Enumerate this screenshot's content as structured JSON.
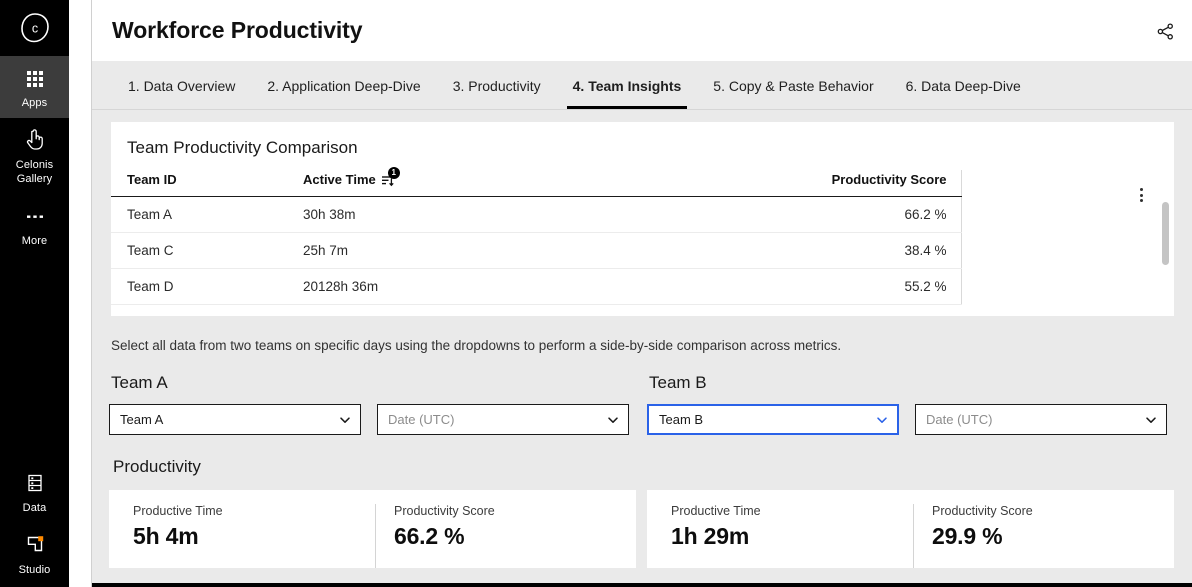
{
  "sidebar": {
    "logo": "celonis-logo",
    "items": [
      {
        "label": "Apps",
        "icon": "apps-grid-icon",
        "active": true
      },
      {
        "label": "Celonis\nGallery",
        "icon": "hand-pointer-icon",
        "active": false
      },
      {
        "label": "More",
        "icon": "ellipsis-icon",
        "active": false
      }
    ],
    "bottom_items": [
      {
        "label": "Data",
        "icon": "database-icon"
      },
      {
        "label": "Studio",
        "icon": "studio-icon"
      }
    ]
  },
  "header": {
    "title": "Workforce Productivity",
    "share_icon": "share-icon"
  },
  "tabs": [
    {
      "label": "1. Data Overview",
      "active": false
    },
    {
      "label": "2. Application Deep-Dive",
      "active": false
    },
    {
      "label": "3. Productivity",
      "active": false
    },
    {
      "label": "4. Team Insights",
      "active": true
    },
    {
      "label": "5. Copy & Paste Behavior",
      "active": false
    },
    {
      "label": "6. Data Deep-Dive",
      "active": false
    }
  ],
  "table": {
    "title": "Team Productivity Comparison",
    "sort_badge": "1",
    "sort_icon": "sort-descending-icon",
    "menu_icon": "kebab-menu-icon",
    "columns": [
      "Team ID",
      "Active Time",
      "Productivity Score"
    ],
    "rows": [
      {
        "team_id": "Team A",
        "active_time": "30h 38m",
        "productivity_score": "66.2 %"
      },
      {
        "team_id": "Team C",
        "active_time": "25h 7m",
        "productivity_score": "38.4 %"
      },
      {
        "team_id": "Team D",
        "active_time": "20128h 36m",
        "productivity_score": "55.2 %"
      }
    ]
  },
  "instruction": "Select all data from two teams on specific days using the dropdowns to perform a side-by-side comparison across metrics.",
  "selectors": {
    "team_a": {
      "group_title": "Team A",
      "team_dropdown_value": "Team A",
      "date_dropdown_placeholder": "Date (UTC)"
    },
    "team_b": {
      "group_title": "Team B",
      "team_dropdown_value": "Team B",
      "date_dropdown_placeholder": "Date (UTC)"
    }
  },
  "metrics": {
    "section_title": "Productivity",
    "left": {
      "productive_time_label": "Productive Time",
      "productive_time_value": "5h 4m",
      "productivity_score_label": "Productivity Score",
      "productivity_score_value": "66.2 %"
    },
    "right": {
      "productive_time_label": "Productive Time",
      "productive_time_value": "1h 29m",
      "productivity_score_label": "Productivity Score",
      "productivity_score_value": "29.9 %"
    }
  },
  "colors": {
    "sidebar_bg": "#000000",
    "panel_bg": "#eaeaea",
    "accent_focus": "#2a62e8",
    "studio_accent": "#ff8a00"
  }
}
